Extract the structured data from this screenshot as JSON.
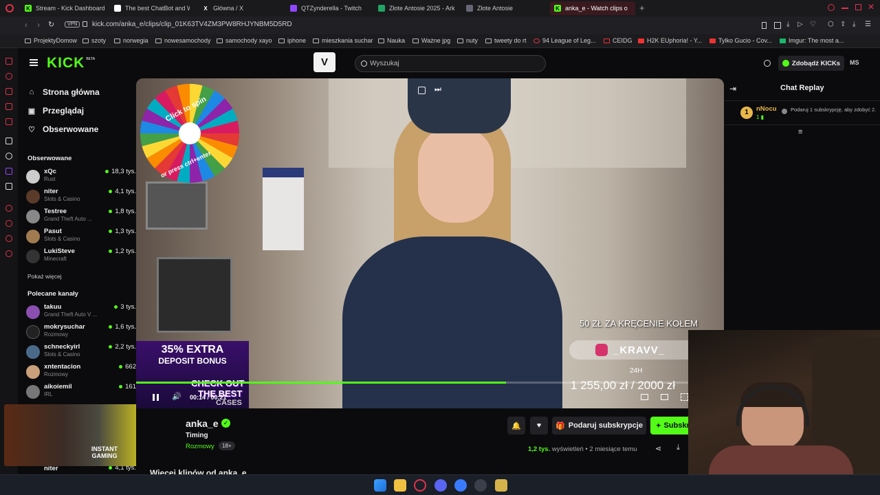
{
  "browser": {
    "tabs": [
      {
        "title": "Stream - Kick Dashboard"
      },
      {
        "title": "The best ChatBot and Wi"
      },
      {
        "title": "Główna / X"
      },
      {
        "title": "QTZynderella - Twitch"
      },
      {
        "title": "Złote Antosie 2025 - Arkus"
      },
      {
        "title": "Złote Antosie"
      },
      {
        "title": "anka_e - Watch clips o"
      }
    ],
    "url": "kick.com/anka_e/clips/clip_01K63TV4ZM3PW8RHJYNBM5D5RD",
    "vpn_label": "VPN",
    "bookmarks": [
      "ProjektyDomow",
      "szoty",
      "norwegia",
      "nowesamochody",
      "samochody xayo",
      "iphone",
      "mieszkania suchar",
      "Nauka",
      "Ważne jpg",
      "nuty",
      "tweety do rt",
      "94 League of Leg...",
      "CEIDG",
      "H2K EUphoria! - Y...",
      "Tylko Gucio - Cov...",
      "Imgur: The most a..."
    ]
  },
  "kick": {
    "logo": "KICK",
    "logo_beta": "BETA",
    "search_placeholder": "Wyszukaj",
    "get_kicks": "Zdobądź KICKs",
    "user_initials": "MS",
    "nav": [
      "Strona główna",
      "Przeglądaj",
      "Obserwowane"
    ],
    "followed_title": "Obserwowane",
    "followed": [
      {
        "name": "xQc",
        "category": "Rust",
        "viewers": "18,3 tys."
      },
      {
        "name": "niter",
        "category": "Slots & Casino",
        "viewers": "4,1 tys."
      },
      {
        "name": "Testree",
        "category": "Grand Theft Auto ...",
        "viewers": "1,8 tys."
      },
      {
        "name": "Pasut",
        "category": "Slots & Casino",
        "viewers": "1,3 tys."
      },
      {
        "name": "LukiSteve",
        "category": "Minecraft",
        "viewers": "1,2 tys."
      }
    ],
    "show_more": "Pokaż więcej",
    "recommended_title": "Polecane kanały",
    "recommended": [
      {
        "name": "takuu",
        "category": "Grand Theft Auto V ...",
        "viewers": "3 tys."
      },
      {
        "name": "mokrysuchar",
        "category": "Rozmowy",
        "viewers": "1,6 tys."
      },
      {
        "name": "schneckyirl",
        "category": "Slots & Casino",
        "viewers": "2,2 tys."
      },
      {
        "name": "xntentacion",
        "category": "Rozmowy",
        "viewers": "662"
      },
      {
        "name": "aikoiemil",
        "category": "IRL",
        "viewers": "161"
      }
    ],
    "bottom_channel": {
      "name": "niter",
      "viewers": "4,1 tys."
    },
    "ad_text": "INSTANT GAMING"
  },
  "player": {
    "wheel_text_1": "Click to spin",
    "wheel_text_2": "or press ctrl+enter",
    "overlay_price": "50 ZŁ ZA KRĘCENIE KOŁEM",
    "overlay_handle": "_KRAVV_",
    "bonus_line1": "35% EXTRA",
    "bonus_line2": "DEPOSIT BONUS",
    "check_out": "CHECK OUT",
    "the_best": "THE BEST",
    "cases": "CASES",
    "goal_period": "24H",
    "goal_amount": "1 255,00 zł / 2000 zł",
    "time_current": "00:14",
    "time_total": "00:21",
    "progress": 0.67
  },
  "clip": {
    "streamer": "anka_e",
    "title": "Timing",
    "category": "Rozmowy",
    "age": "18+",
    "gift_subs": "Podaruj subskrypcje",
    "subscribe": "Subskrybuj",
    "views_count": "1,2 tys.",
    "views_label": "wyświetleń",
    "posted": "2 miesiące temu",
    "more_clips": "Więcej klipów od anka_e"
  },
  "chat": {
    "title": "Chat Replay",
    "user": "nNocu",
    "badge_rank": "1",
    "badge_sub": "1",
    "message": "Podaruj 1 subskrypcję, aby zdobyć 2."
  }
}
